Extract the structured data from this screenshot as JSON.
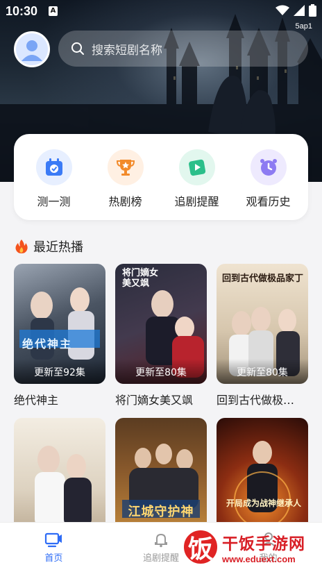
{
  "status_bar": {
    "time": "10:30",
    "notification_letter": "A",
    "carrier_text": "5ap1"
  },
  "search": {
    "placeholder": "搜索短剧名称"
  },
  "quick_actions": [
    {
      "label": "测一测",
      "icon": "calendar-check-icon",
      "color": "#3b7bf6"
    },
    {
      "label": "热剧榜",
      "icon": "trophy-icon",
      "color": "#f28a2a"
    },
    {
      "label": "追剧提醒",
      "icon": "play-tag-icon",
      "color": "#2bbf8a"
    },
    {
      "label": "观看历史",
      "icon": "clock-icon",
      "color": "#8d7bf2"
    }
  ],
  "recent": {
    "section_title": "最近热播",
    "section_icon": "fire-icon",
    "items": [
      {
        "title": "绝代神主",
        "badge": "更新至92集",
        "poster_text": "绝代神主"
      },
      {
        "title": "将门嫡女美又飒",
        "badge": "更新至80集",
        "poster_text": "将门嫡女美又飒"
      },
      {
        "title": "回到古代做极…",
        "badge": "更新至80集",
        "poster_text": "回到古代做极品家丁"
      },
      {
        "title": "",
        "badge": "",
        "poster_text": ""
      },
      {
        "title": "",
        "badge": "",
        "poster_text": "江城守护神"
      },
      {
        "title": "",
        "badge": "",
        "poster_text": "开局成为战神继承人"
      }
    ]
  },
  "tabbar": {
    "tabs": [
      {
        "label": "首页",
        "icon": "tv-icon",
        "active": true
      },
      {
        "label": "追剧提醒",
        "icon": "bell-icon",
        "active": false
      },
      {
        "label": "我的",
        "icon": "user-icon",
        "active": false
      }
    ]
  },
  "watermark": {
    "logo_char": "饭",
    "name": "干饭手游网",
    "url": "www.eduext.com"
  },
  "colors": {
    "accent": "#2e6cf6",
    "background": "#f4f4f6"
  }
}
